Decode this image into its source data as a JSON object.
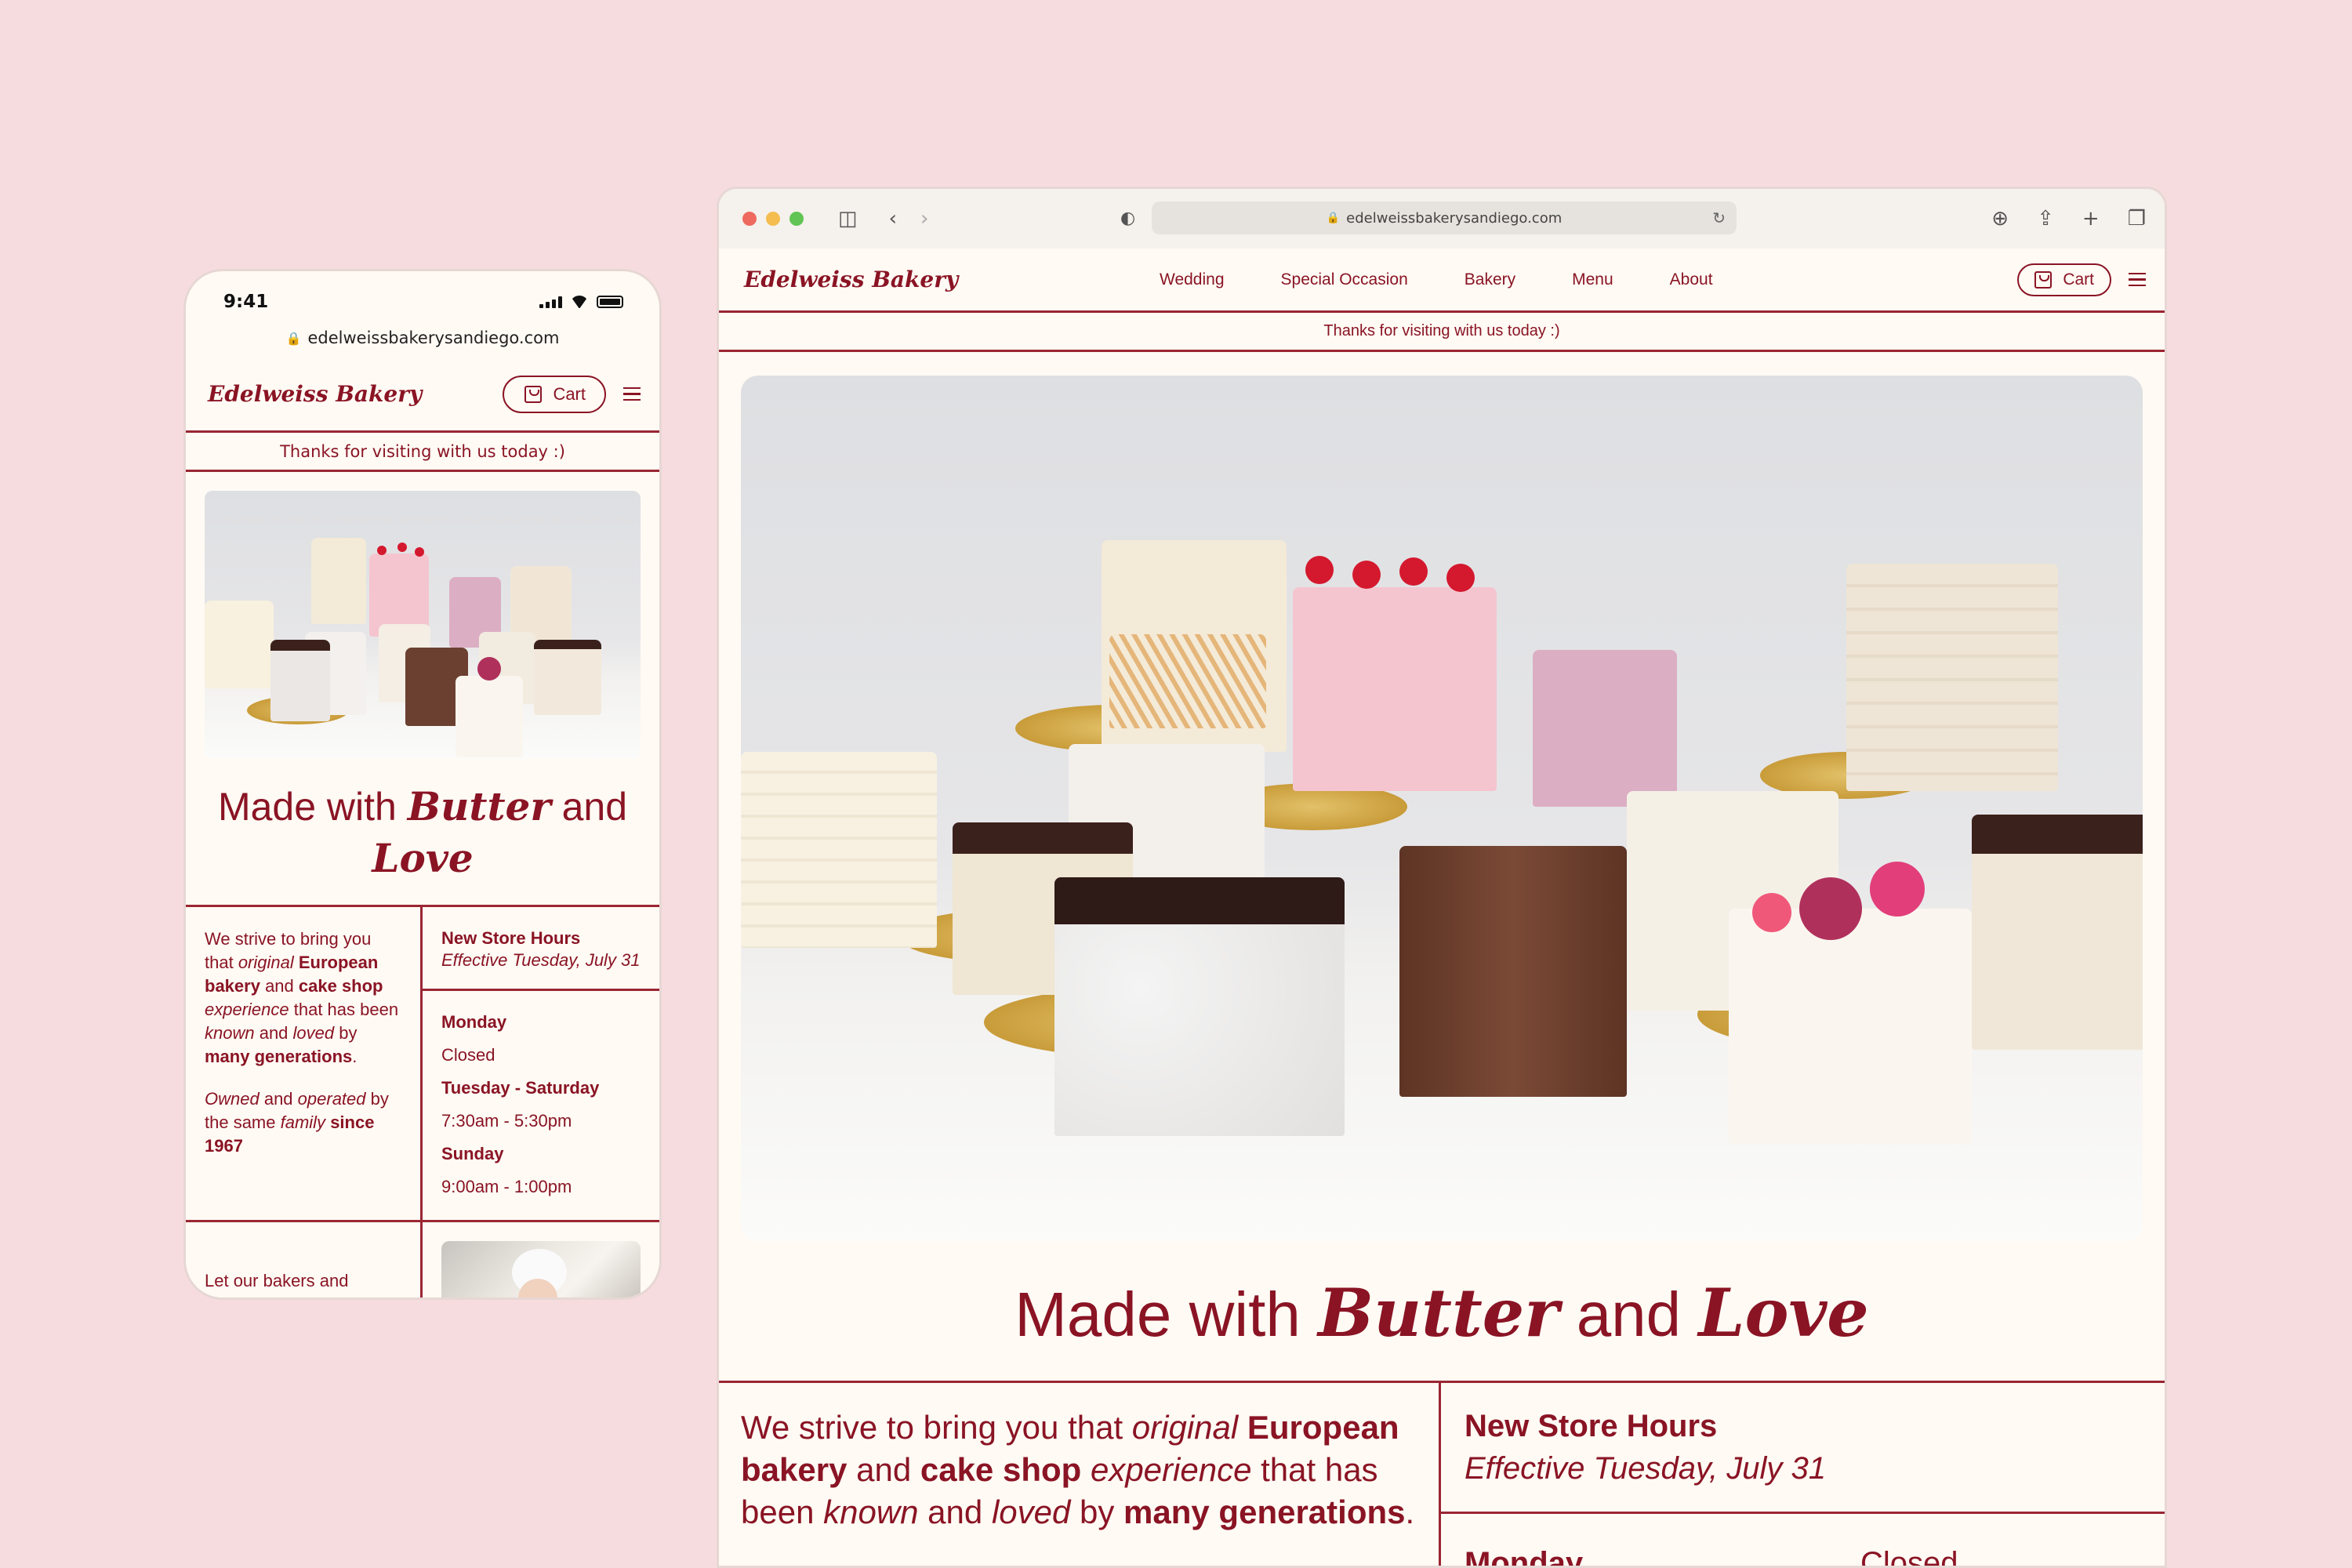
{
  "brand": {
    "logo": "Edelweiss Bakery",
    "cart_label": "Cart",
    "url": "edelweissbakerysandiego.com",
    "banner": "Thanks for visiting with us today :)"
  },
  "phone": {
    "time": "9:41"
  },
  "nav": {
    "items": [
      "Wedding",
      "Special Occasion",
      "Bakery",
      "Menu",
      "About"
    ]
  },
  "hero": {
    "prefix": "Made with",
    "word1": "Butter",
    "mid": "and",
    "word2": "Love"
  },
  "about": {
    "p1": [
      "We strive to bring you that ",
      "original",
      " ",
      "European bakery",
      " and ",
      "cake shop",
      " ",
      "experience",
      " that has been ",
      "known",
      " and ",
      "loved",
      " by ",
      "many generations",
      "."
    ],
    "p2": [
      "Owned",
      " and ",
      "operated",
      " by the same ",
      "family",
      " ",
      "since 1967"
    ],
    "bakers_text": "Let our bakers and decorators create that"
  },
  "hours": {
    "title": "New Store Hours",
    "effective": "Effective Tuesday, July 31",
    "days": [
      {
        "day": "Monday",
        "time": "Closed"
      },
      {
        "day": "Tuesday - Saturday",
        "time": "7:30am - 5:30pm"
      },
      {
        "day": "Sunday",
        "time": "9:00am - 1:00pm"
      }
    ]
  },
  "colors": {
    "background": "#f7dcdf",
    "cream": "#fffaf4",
    "maroon": "#8a1424"
  },
  "icons": [
    "lock-icon",
    "reload-icon",
    "sidebar-icon",
    "back-icon",
    "forward-icon",
    "shield-icon",
    "download-icon",
    "share-icon",
    "new-tab-icon",
    "tabs-icon",
    "cart-bag-icon",
    "menu-icon"
  ]
}
